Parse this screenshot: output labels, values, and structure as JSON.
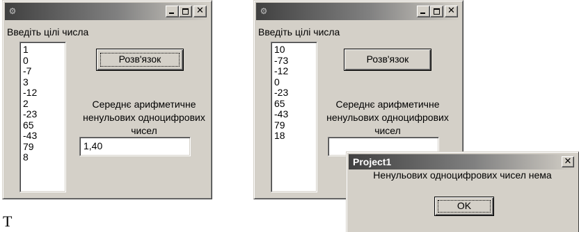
{
  "colors": {
    "face": "#d4d0c8",
    "titlebar_dark": "#404040",
    "titlebar_light": "#d4d0c8",
    "field": "#ffffff"
  },
  "windows": [
    {
      "icon": "delphi-app-icon",
      "prompt_label": "Введіть цілі числа",
      "numbers": [
        "1",
        "0",
        "-7",
        "3",
        "-12",
        "2",
        "-23",
        "65",
        "-43",
        "79",
        "8"
      ],
      "solve_button_label": "Розв'язок",
      "result_caption": "Середнє арифметичне ненульових одноцифрових чисел",
      "result_value": "1,40"
    },
    {
      "icon": "delphi-app-icon",
      "prompt_label": "Введіть цілі числа",
      "numbers": [
        "10",
        "-73",
        "-12",
        "0",
        "-23",
        "65",
        "-43",
        "79",
        "18"
      ],
      "solve_button_label": "Розв'язок",
      "result_caption": "Середнє арифметичне ненульових одноцифрових чисел",
      "result_value": ""
    }
  ],
  "message_box": {
    "title": "Project1",
    "text": "Ненульових одноцифрових чисел нема",
    "ok_label": "OK"
  },
  "footer_text": "Т"
}
